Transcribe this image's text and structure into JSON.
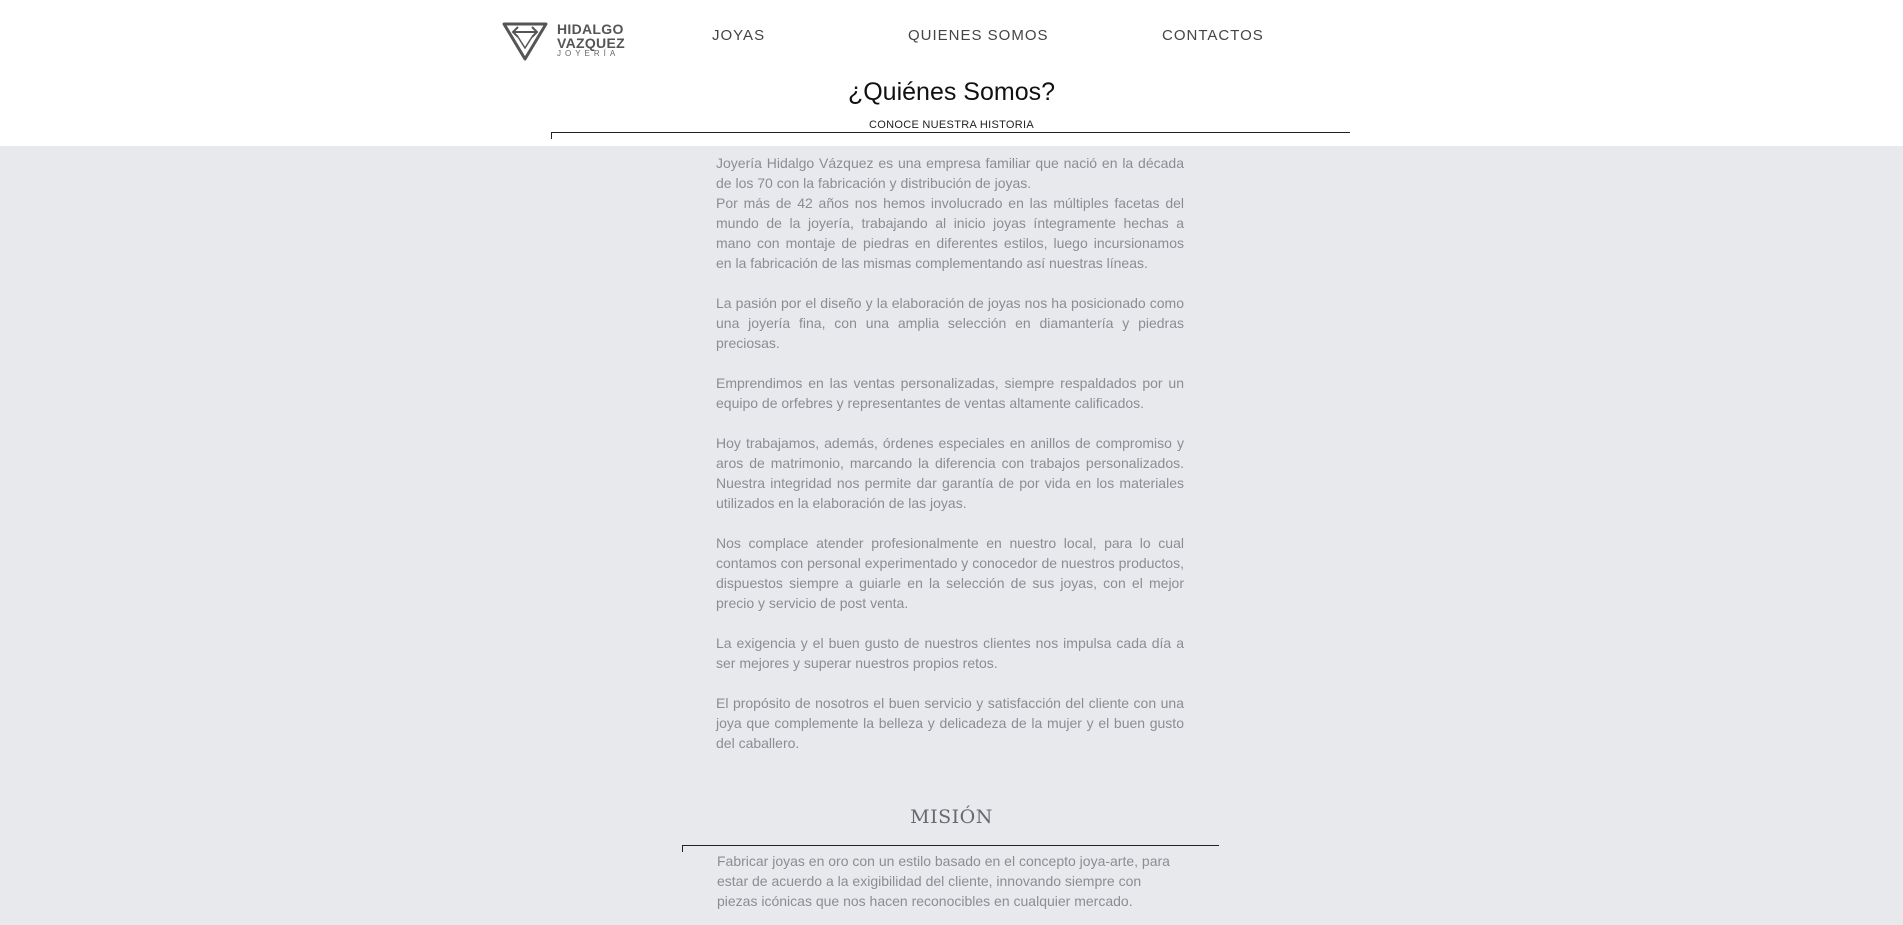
{
  "header": {
    "logo": {
      "line1": "HIDALGO",
      "line2": "VAZQUEZ",
      "line3": "JOYERÍA"
    },
    "nav": [
      {
        "label": "JOYAS"
      },
      {
        "label": "QUIENES SOMOS"
      },
      {
        "label": "CONTACTOS"
      }
    ]
  },
  "page": {
    "title": "¿Quiénes Somos?",
    "subtitle": "CONOCE NUESTRA HISTORIA"
  },
  "story": {
    "paragraphs": [
      "Joyería Hidalgo Vázquez es una empresa familiar que nació en la década de los 70 con la fabricación y distribución de joyas.",
      "Por más de 42 años nos hemos involucrado en las múltiples facetas del mundo de la joyería, trabajando al inicio joyas íntegramente hechas a mano con montaje de piedras en diferentes estilos, luego incursionamos en la fabricación de las mismas complementando así  nuestras líneas.",
      "La pasión por el diseño y la elaboración de joyas nos ha posicionado como una  joyería fina, con una amplia selección en diamantería y piedras preciosas.",
      "Emprendimos en las ventas personalizadas, siempre respaldados por un equipo de orfebres y representantes de ventas altamente calificados.",
      "Hoy trabajamos, además, órdenes especiales en anillos de compromiso y aros de matrimonio, marcando la diferencia con trabajos personalizados. Nuestra integridad nos permite dar garantía de por vida en los materiales utilizados en la elaboración de las joyas.",
      "Nos complace atender profesionalmente en nuestro local, para lo cual contamos con personal experimentado y conocedor de nuestros productos, dispuestos siempre a guiarle en la selección de sus joyas, con el mejor precio  y servicio de post venta.",
      "La exigencia y el buen gusto de nuestros clientes nos impulsa cada día a ser mejores y superar nuestros propios retos.",
      "El propósito de nosotros el buen servicio y satisfacción del cliente con una joya que complemente la belleza y delicadeza de la mujer y el buen gusto del caballero."
    ]
  },
  "mision": {
    "title": "MISIÓN",
    "text": "Fabricar joyas en oro con un estilo basado en el concepto joya-arte, para estar de acuerdo a la exigibilidad del cliente, innovando siempre con piezas icónicas que nos hacen reconocibles en cualquier mercado."
  }
}
